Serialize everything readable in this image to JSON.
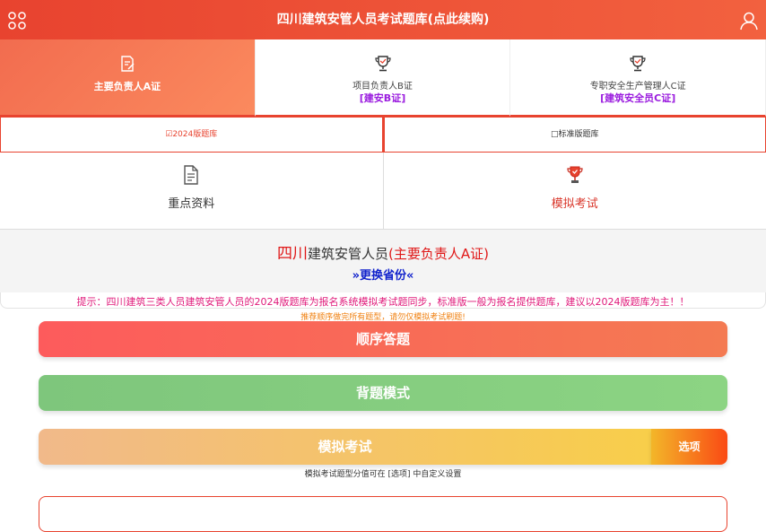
{
  "header": {
    "title": "四川建筑安管人员考试题库(点此续购)",
    "menu_icon": "grid-icon",
    "user_icon": "user-icon"
  },
  "certs": [
    {
      "label": "主要负责人A证",
      "icon": "edit-document-icon",
      "active": true
    },
    {
      "label": "项目负责人B证",
      "tag": "[建安B证]",
      "icon": "trophy-icon"
    },
    {
      "label": "专职安全生产管理人C证",
      "tag": "[建筑安全员C证]",
      "icon": "trophy-icon"
    }
  ],
  "banks": [
    {
      "label": "☑2024版题库",
      "selected": true
    },
    {
      "label": "□标准版题库",
      "selected": false
    }
  ],
  "features": [
    {
      "label": "重点资料",
      "icon": "document-icon"
    },
    {
      "label": "模拟考试",
      "icon": "trophy-icon"
    }
  ],
  "info": {
    "province": "四川",
    "org": "建筑安管人员",
    "cert": "(主要负责人A证)",
    "switch_label": "»更换省份«"
  },
  "notice": "提示：四川建筑三类人员建筑安管人员的2024版题库为报名系统模拟考试题同步，标准版一般为报名提供题库，建议以2024版题库为主！！",
  "hint": "推荐顺序做完所有题型，请勿仅模拟考试刷题!",
  "buttons": {
    "order": "顺序答题",
    "recite": "背题模式",
    "exam": "模拟考试",
    "options": "选项"
  },
  "exam_note": "模拟考试题型分值可在 [选项] 中自定义设置",
  "colors": {
    "header_bg": "#e8432f",
    "accent_red": "#e01818",
    "tag_purple": "#9b1ddf",
    "link_blue": "#1122cc",
    "notice_pink": "#e0197a",
    "hint_orange": "#f08010"
  }
}
